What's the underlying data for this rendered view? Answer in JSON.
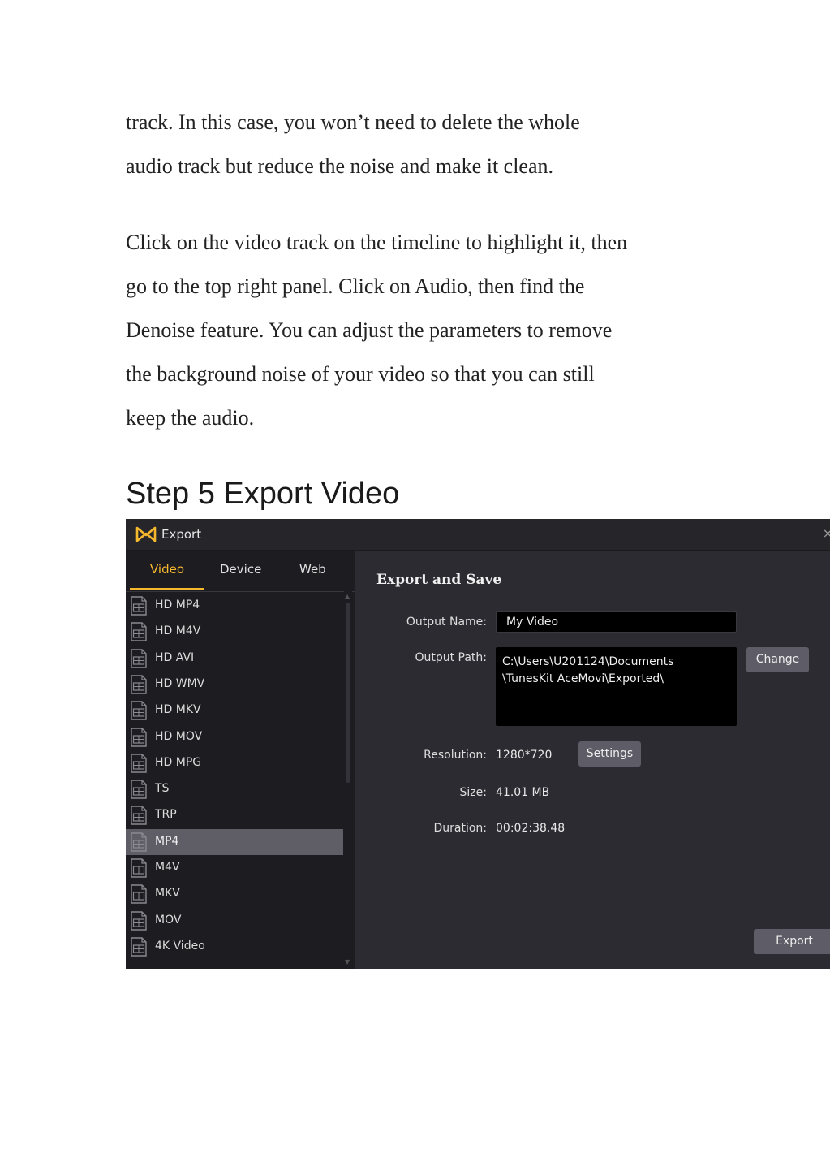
{
  "paragraphs": [
    [
      "track. In this case, you won’t need to delete the whole",
      "audio track but reduce the noise and make it clean."
    ],
    [
      "Click on the video track on the timeline to highlight it, then",
      "go to the top right panel. Click on Audio, then find the",
      "Denoise feature. You can adjust the parameters to remove",
      "the background noise of your video so that you can still",
      "keep the audio."
    ]
  ],
  "heading": "Step 5 Export Video",
  "app": {
    "window_title": "Export",
    "close_label": "×",
    "tabs": [
      "Video",
      "Device",
      "Web"
    ],
    "active_tab": "Video",
    "formats": [
      "HD MP4",
      "HD M4V",
      "HD AVI",
      "HD WMV",
      "HD MKV",
      "HD MOV",
      "HD MPG",
      "TS",
      "TRP",
      "MP4",
      "M4V",
      "MKV",
      "MOV",
      "4K Video"
    ],
    "selected_format": "MP4",
    "section_title": "Export and Save",
    "output_name_label": "Output Name:",
    "output_name_value": "My Video",
    "output_path_label": "Output Path:",
    "output_path_lines": [
      "C:\\Users\\U201124\\Documents",
      "\\TunesKit AceMovi\\Exported\\"
    ],
    "change_button": "Change",
    "resolution_label": "Resolution:",
    "resolution_value": "1280*720",
    "settings_button": "Settings",
    "size_label": "Size:",
    "size_value": "41.01 MB",
    "duration_label": "Duration:",
    "duration_value": "00:02:38.48",
    "export_button": "Export",
    "accent_color": "#f5b82e",
    "selected_row_color": "#5f5d66"
  }
}
